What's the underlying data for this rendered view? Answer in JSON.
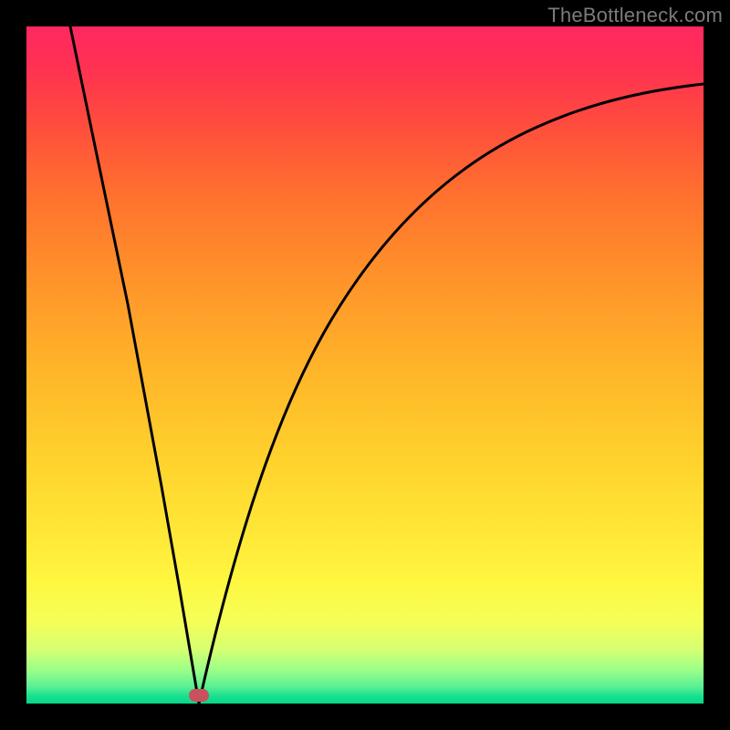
{
  "watermark": "TheBottleneck.com",
  "marker": {
    "x_frac": 0.255,
    "y_frac": 0.988
  },
  "chart_data": {
    "type": "line",
    "title": "",
    "xlabel": "",
    "ylabel": "",
    "xlim": [
      0,
      1
    ],
    "ylim": [
      0,
      1
    ],
    "grid": false,
    "legend": false,
    "background_gradient": {
      "top": "#ff2860",
      "middle": "#ffd22c",
      "bottom": "#08d68a"
    },
    "series": [
      {
        "name": "bottleneck-curve",
        "color": "#000000",
        "x": [
          0.065,
          0.1,
          0.15,
          0.2,
          0.225,
          0.255,
          0.28,
          0.31,
          0.34,
          0.37,
          0.4,
          0.45,
          0.5,
          0.55,
          0.6,
          0.65,
          0.7,
          0.75,
          0.8,
          0.85,
          0.9,
          0.95,
          1.0
        ],
        "values": [
          1.0,
          0.83,
          0.59,
          0.32,
          0.175,
          0.0,
          0.11,
          0.24,
          0.34,
          0.42,
          0.49,
          0.58,
          0.65,
          0.71,
          0.755,
          0.79,
          0.82,
          0.845,
          0.865,
          0.882,
          0.895,
          0.905,
          0.915
        ]
      }
    ],
    "annotations": [
      {
        "type": "marker",
        "shape": "pill",
        "color": "#c9515d",
        "x": 0.255,
        "y": 0.012
      }
    ]
  }
}
